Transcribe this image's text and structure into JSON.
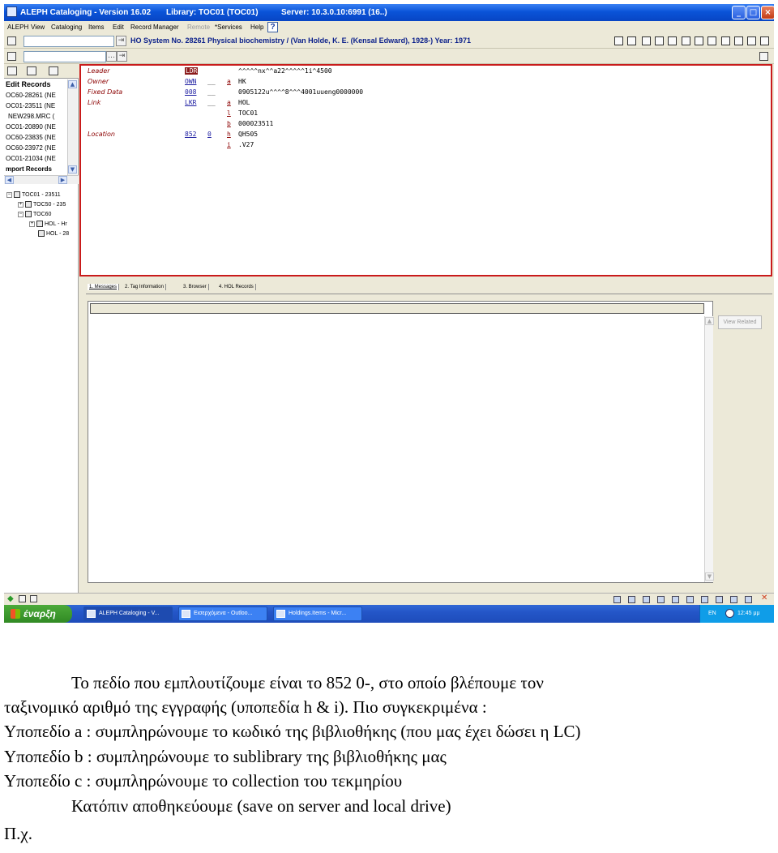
{
  "window": {
    "title": "ALEPH Cataloging - Version 16.02",
    "library": "Library:  TOC01 (TOC01)",
    "server": "Server:  10.3.0.10:6991 (16..)",
    "minimize": "_",
    "maximize": "□",
    "close": "×"
  },
  "menu": [
    "ALEPH",
    "View",
    "Cataloging",
    "Items",
    "Edit",
    "Record Manager",
    "Remote",
    "*Services",
    "Help"
  ],
  "menu_help_icon": "?",
  "record_title": "HO System No. 28261 Physical biochemistry / (Van Holde, K. E. (Kensal Edward), 1928-) Year: 1971",
  "left": {
    "section_title": "Edit Records",
    "records": [
      "OC60-28261 (NE",
      "OC01-23511 (NE",
      "NEW298.MRC (",
      "OC01-20890 (NE",
      "OC60-23835 (NE",
      "OC60-23972 (NE",
      "OC01-21034 (NE",
      "mport Records"
    ],
    "tree": [
      "TOC01 - 23511",
      "TOC50 - 235",
      "TOC60",
      "HOL - Hr",
      "HOL - 28"
    ]
  },
  "editor": {
    "fields": [
      {
        "name": "Leader",
        "tag": "LDR",
        "ind": "",
        "sub": "",
        "value": "^^^^^nx^^a22^^^^^1i^4500"
      },
      {
        "name": "Owner",
        "tag": "OWN",
        "ind": "__",
        "sub": "a",
        "value": "HK"
      },
      {
        "name": "Fixed Data",
        "tag": "008",
        "ind": "__",
        "sub": "",
        "value": "0905122u^^^^8^^^4001uueng0000000"
      },
      {
        "name": "Link",
        "tag": "LKR",
        "ind": "__",
        "sub": "a",
        "value": "HOL"
      },
      {
        "name": "",
        "tag": "",
        "ind": "",
        "sub": "l",
        "value": "TOC01"
      },
      {
        "name": "",
        "tag": "",
        "ind": "",
        "sub": "b",
        "value": "000023511"
      },
      {
        "name": "Location",
        "tag": "852",
        "ind": "0",
        "sub": "h",
        "value": "QH505"
      },
      {
        "name": "",
        "tag": "",
        "ind": "",
        "sub": "i",
        "value": ".V27"
      }
    ]
  },
  "bottom_tabs": [
    "1. Messages",
    "2. Tag Information",
    "3. Browser",
    "4. HOL Records"
  ],
  "view_related_label": "View Related",
  "taskbar": {
    "start_label": "έναρξη",
    "tasks": [
      "ALEPH Cataloging - V...",
      "Εισερχόμενα - Outloo...",
      "Holdings.Items - Micr..."
    ],
    "language": "EN",
    "clock": "12:45 μμ"
  },
  "caption": {
    "line1": "Το πεδίο που εμπλουτίζουμε είναι το 852 0-, στο οποίο βλέπουμε τον",
    "line2": "ταξινομικό αριθμό της εγγραφής (υποπεδία h & i). Πιο συγκεκριμένα :",
    "line3": "Υποπεδίο a : συμπληρώνουμε το κωδικό της βιβλιοθήκης (που μας έχει δώσει η LC)",
    "line4": "Υποπεδίο b : συμπληρώνουμε το sublibrary της βιβλιοθήκης μας",
    "line5": "Υποπεδίο c : συμπληρώνουμε το collection του τεκμηρίου",
    "line6": "Κατόπιν αποθηκεύουμε (save on server and local drive)",
    "line7": "Π.χ."
  }
}
